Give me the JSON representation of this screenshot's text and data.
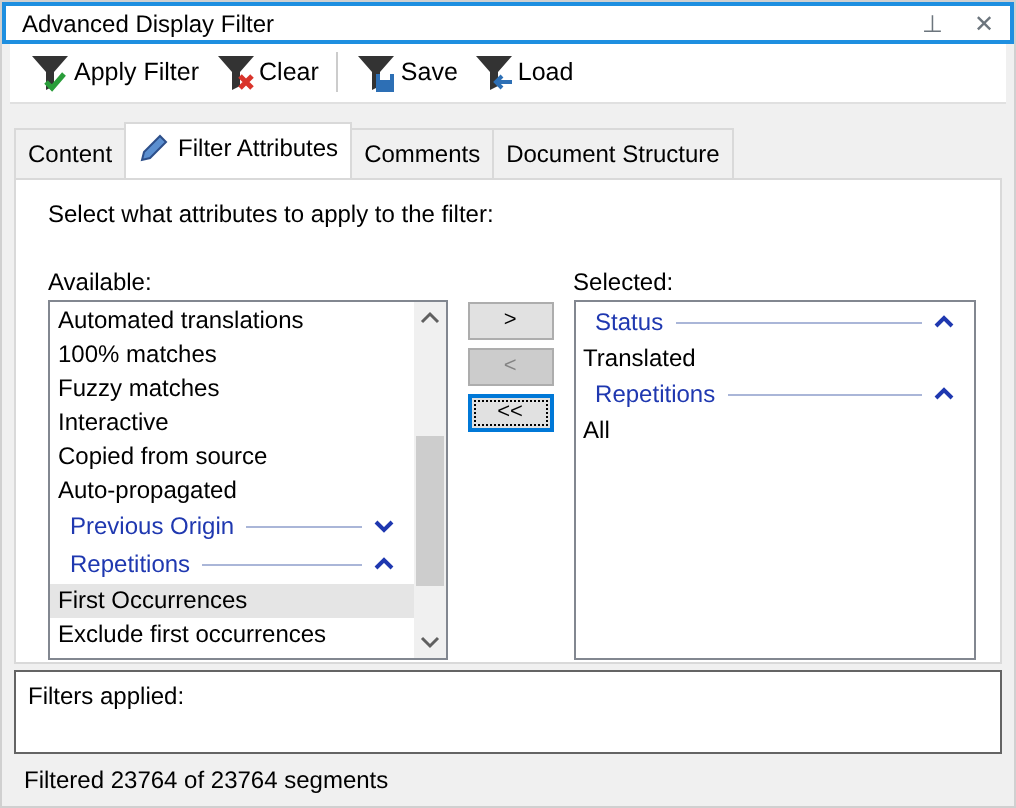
{
  "window": {
    "title": "Advanced Display Filter",
    "pin": "⊥",
    "close": "✕"
  },
  "toolbar": [
    {
      "label": "Apply Filter",
      "kind": "apply"
    },
    {
      "label": "Clear",
      "kind": "clear"
    },
    {
      "label": "Save",
      "kind": "save"
    },
    {
      "label": "Load",
      "kind": "load"
    }
  ],
  "tabs": [
    {
      "label": "Content",
      "selected": false
    },
    {
      "label": "Filter Attributes",
      "selected": true
    },
    {
      "label": "Comments",
      "selected": false
    },
    {
      "label": "Document Structure",
      "selected": false
    }
  ],
  "instruction": "Select what attributes to apply to the filter:",
  "available": {
    "label": "Available:",
    "items": [
      {
        "kind": "item",
        "label": "Automated translations",
        "selected": false
      },
      {
        "kind": "item",
        "label": "100% matches",
        "selected": false
      },
      {
        "kind": "item",
        "label": "Fuzzy matches",
        "selected": false
      },
      {
        "kind": "item",
        "label": "Interactive",
        "selected": false
      },
      {
        "kind": "item",
        "label": "Copied from source",
        "selected": false
      },
      {
        "kind": "item",
        "label": "Auto-propagated",
        "selected": false
      },
      {
        "kind": "group",
        "label": "Previous Origin",
        "expanded": false
      },
      {
        "kind": "group",
        "label": "Repetitions",
        "expanded": true
      },
      {
        "kind": "item",
        "label": "First Occurrences",
        "selected": true
      },
      {
        "kind": "item",
        "label": "Exclude first occurrences",
        "selected": false
      }
    ]
  },
  "move_buttons": [
    {
      "label": ">",
      "disabled": false
    },
    {
      "label": "<",
      "disabled": true
    },
    {
      "label": "<<",
      "disabled": false
    }
  ],
  "selected": {
    "label": "Selected:",
    "items": [
      {
        "kind": "group",
        "label": "Status",
        "expanded": true
      },
      {
        "kind": "item",
        "label": "Translated",
        "selected": false
      },
      {
        "kind": "group",
        "label": "Repetitions",
        "expanded": true
      },
      {
        "kind": "item",
        "label": "All",
        "selected": false
      }
    ]
  },
  "filters_applied": "Filters applied:",
  "status_bar": "Filtered 23764 of 23764 segments"
}
